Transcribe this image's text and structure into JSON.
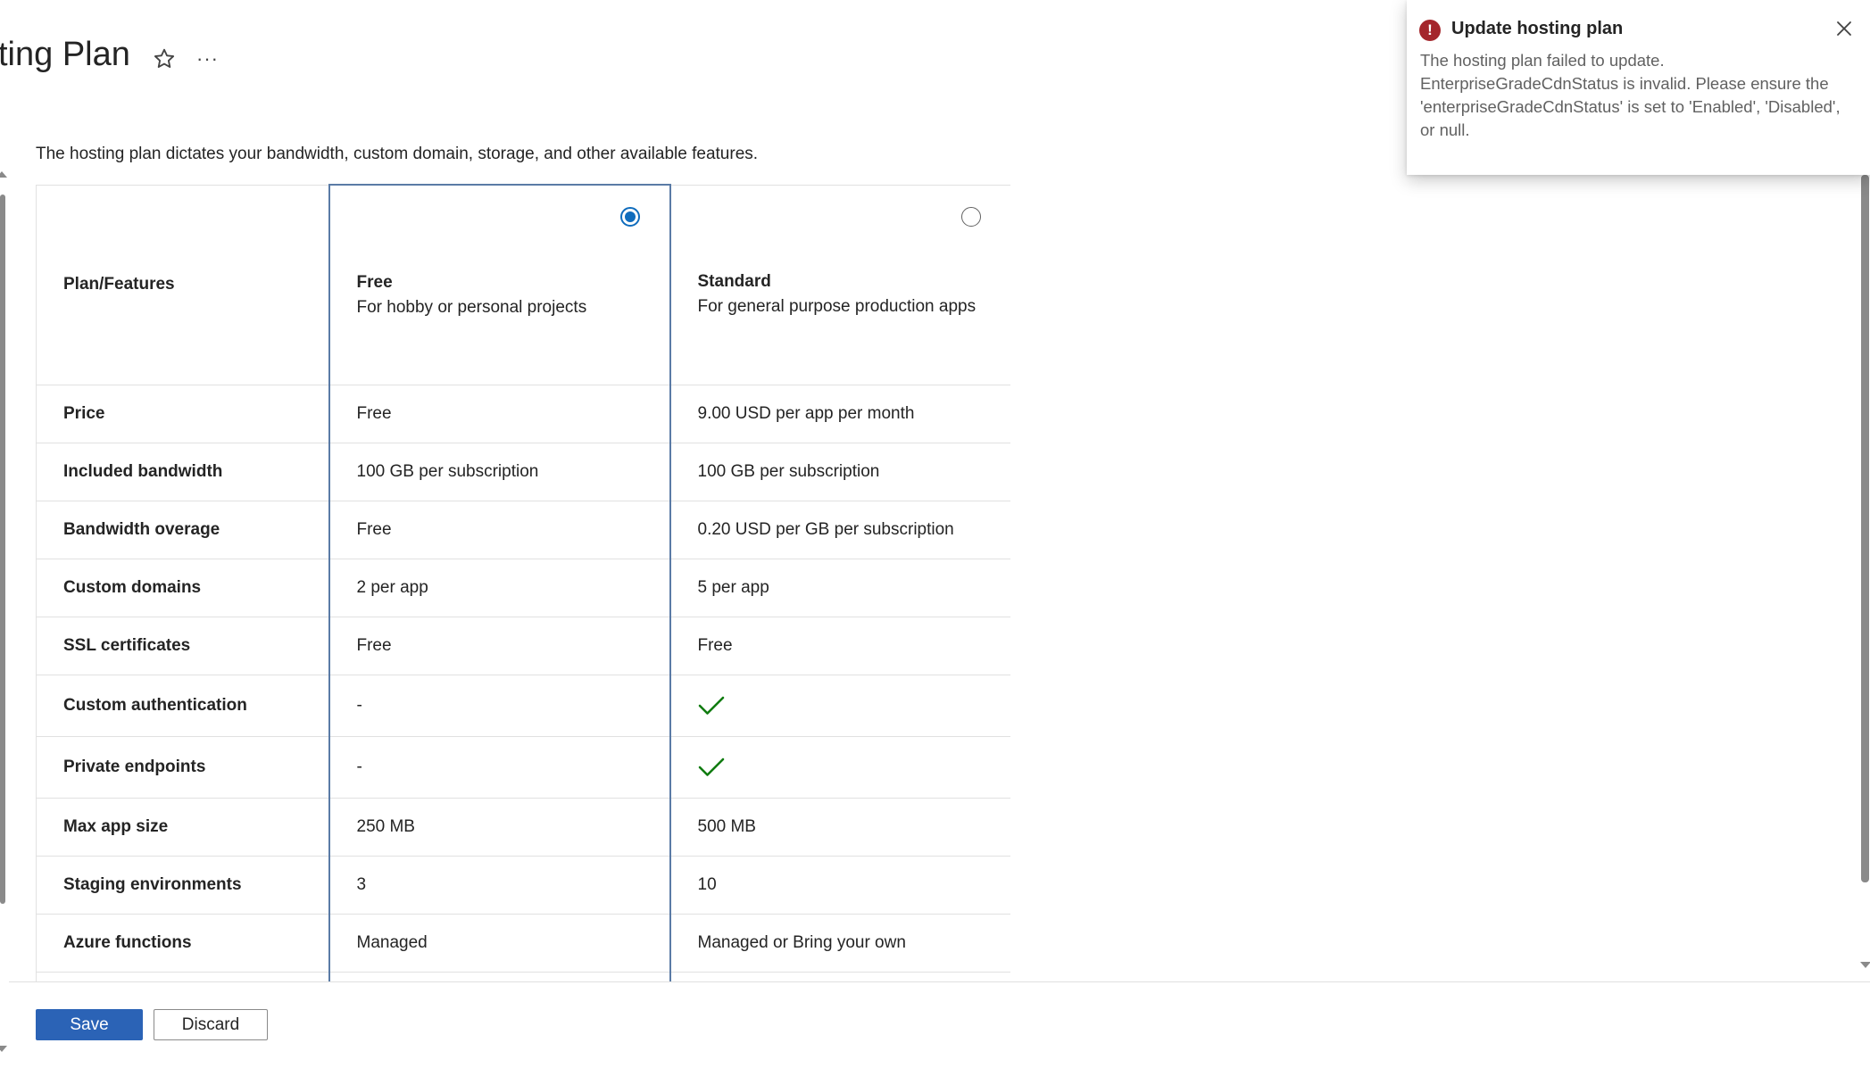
{
  "header": {
    "title": "ting Plan",
    "favorite_icon": "star-outline-icon",
    "more_label": "···"
  },
  "description": "The hosting plan dictates your bandwidth, custom domain, storage, and other available features.",
  "table": {
    "corner_label": "Plan/Features",
    "plans": [
      {
        "name": "Free",
        "subtitle": "For hobby or personal projects",
        "selected": true
      },
      {
        "name": "Standard",
        "subtitle": "For general purpose production apps",
        "selected": false
      }
    ],
    "rows": [
      {
        "feature": "Price",
        "free": "Free",
        "standard": "9.00 USD per app per month"
      },
      {
        "feature": "Included bandwidth",
        "free": "100 GB per subscription",
        "standard": "100 GB per subscription"
      },
      {
        "feature": "Bandwidth overage",
        "free": "Free",
        "standard": "0.20 USD per GB per subscription"
      },
      {
        "feature": "Custom domains",
        "free": "2 per app",
        "standard": "5 per app"
      },
      {
        "feature": "SSL certificates",
        "free": "Free",
        "standard": "Free"
      },
      {
        "feature": "Custom authentication",
        "free": "-",
        "standard": "check-icon"
      },
      {
        "feature": "Private endpoints",
        "free": "-",
        "standard": "check-icon"
      },
      {
        "feature": "Max app size",
        "free": "250 MB",
        "standard": "500 MB"
      },
      {
        "feature": "Staging environments",
        "free": "3",
        "standard": "10"
      },
      {
        "feature": "Azure functions",
        "free": "Managed",
        "standard": "Managed or Bring your own"
      }
    ]
  },
  "footer": {
    "save_label": "Save",
    "discard_label": "Discard"
  },
  "notification": {
    "icon": "error-icon",
    "title": "Update hosting plan",
    "body_lines": [
      "The hosting plan failed to update.",
      "EnterpriseGradeCdnStatus is invalid.  Please ensure the",
      "'enterpriseGradeCdnStatus' is set to 'Enabled', 'Disabled',",
      "or null."
    ]
  },
  "colors": {
    "primary": "#2b63b6",
    "radio_selected": "#0f6cbd",
    "check": "#107c10",
    "error": "#a4262c",
    "selected_column_border": "#5a7ba6"
  }
}
